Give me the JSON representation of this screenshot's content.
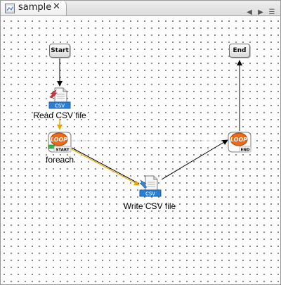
{
  "tab": {
    "title": "sample",
    "close_glyph": "✕"
  },
  "tab_controls": {
    "prev": "◀",
    "next": "▶",
    "menu": "☰"
  },
  "nodes": {
    "start": {
      "label": "Start"
    },
    "end": {
      "label": "End"
    },
    "read_csv": {
      "label": "Read CSV file",
      "badge": "CSV",
      "icon": "csv-read-icon"
    },
    "foreach": {
      "label": "foreach",
      "badge": "LOOP",
      "tag": "START",
      "icon": "loop-start-icon"
    },
    "write_csv": {
      "label": "Write CSV file",
      "badge": "CSV",
      "icon": "csv-write-icon"
    },
    "loop_end": {
      "badge": "LOOP",
      "tag": "END",
      "icon": "loop-end-icon"
    }
  },
  "colors": {
    "flow_edge": "#000000",
    "data_edge": "#e8a800",
    "loop_link": "#c8c8c8",
    "badge_blue": "#2a7fd4",
    "loop_orange": "#e86a1a"
  }
}
